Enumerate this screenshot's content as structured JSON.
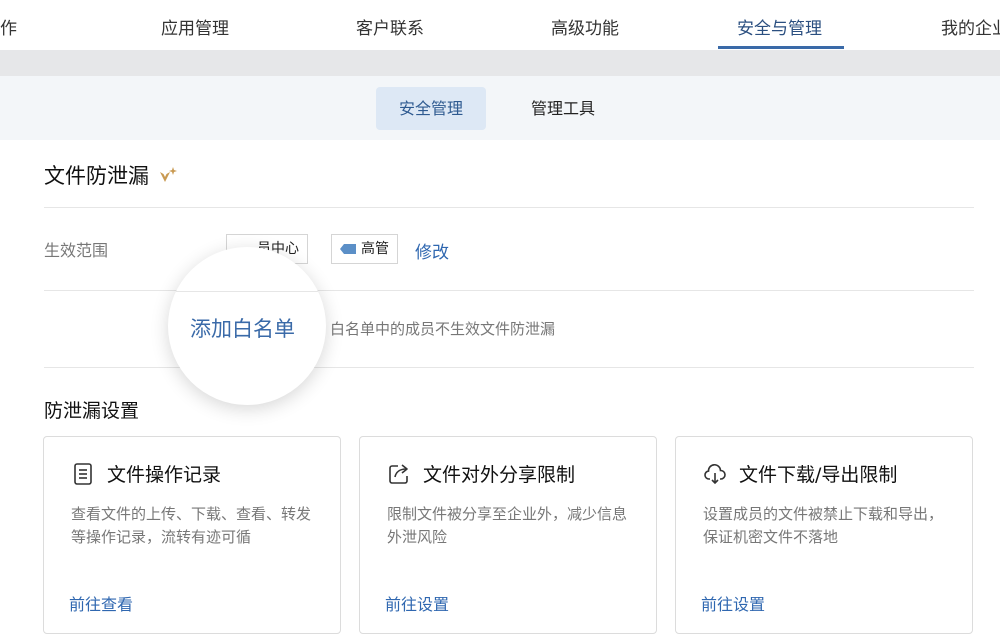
{
  "topnav": {
    "items": [
      {
        "label": "作"
      },
      {
        "label": "应用管理"
      },
      {
        "label": "客户联系"
      },
      {
        "label": "高级功能"
      },
      {
        "label": "安全与管理"
      },
      {
        "label": "我的企业"
      }
    ],
    "active_index": 4
  },
  "subtabs": {
    "items": [
      {
        "label": "安全管理"
      },
      {
        "label": "管理工具"
      }
    ],
    "active_index": 0
  },
  "section": {
    "title": "文件防泄漏",
    "scope_label": "生效范围",
    "scope_tags": [
      {
        "label": "员中心"
      },
      {
        "label": "高管"
      }
    ],
    "modify_label": "修改",
    "whitelist_button": "添加白名单",
    "whitelist_desc": "白名单中的成员不生效文件防泄漏"
  },
  "settings": {
    "title": "防泄漏设置",
    "cards": [
      {
        "title": "文件操作记录",
        "desc": "查看文件的上传、下载、查看、转发等操作记录，流转有迹可循",
        "link": "前往查看",
        "icon": "document-list-icon"
      },
      {
        "title": "文件对外分享限制",
        "desc": "限制文件被分享至企业外，减少信息外泄风险",
        "link": "前往设置",
        "icon": "share-out-icon"
      },
      {
        "title": "文件下载/导出限制",
        "desc": "设置成员的文件被禁止下载和导出，保证机密文件不落地",
        "link": "前往设置",
        "icon": "cloud-download-icon"
      }
    ]
  },
  "colors": {
    "accent": "#2f67b0",
    "nav_underline": "#3a6aa8",
    "sparkle": "#c99a52"
  }
}
